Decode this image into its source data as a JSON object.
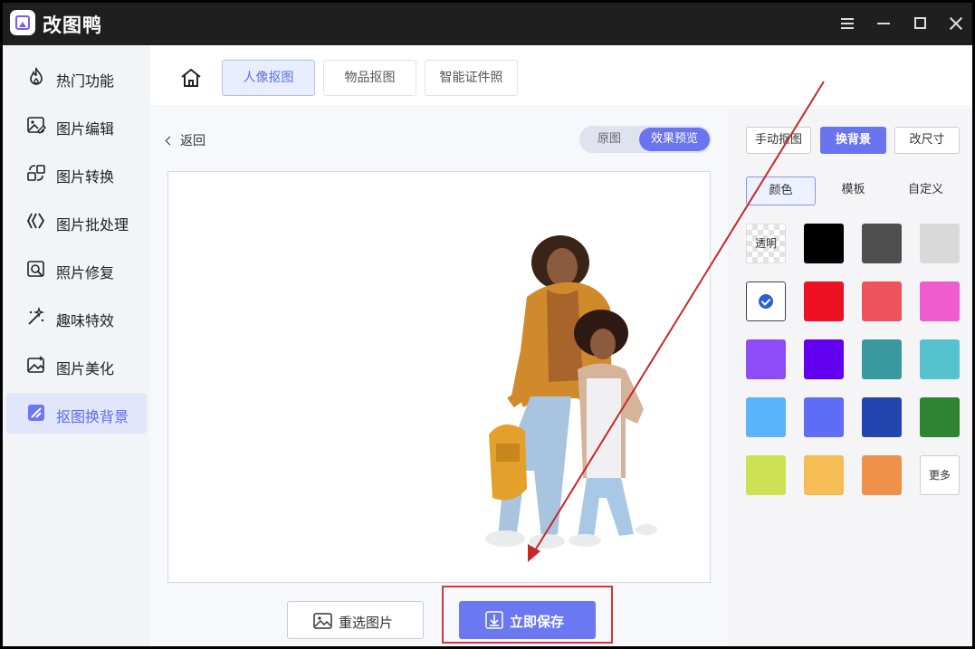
{
  "app": {
    "title": "改图鸭"
  },
  "sidebar": {
    "items": [
      {
        "label": "热门功能",
        "icon": "flame-icon"
      },
      {
        "label": "图片编辑",
        "icon": "image-edit-icon"
      },
      {
        "label": "图片转换",
        "icon": "convert-icon"
      },
      {
        "label": "图片批处理",
        "icon": "batch-icon"
      },
      {
        "label": "照片修复",
        "icon": "photo-repair-icon"
      },
      {
        "label": "趣味特效",
        "icon": "magic-wand-icon"
      },
      {
        "label": "图片美化",
        "icon": "image-beautify-icon"
      },
      {
        "label": "抠图换背景",
        "icon": "cutout-icon",
        "active": true
      }
    ]
  },
  "top_tabs": [
    "人像抠图",
    "物品抠图",
    "智能证件照"
  ],
  "workspace": {
    "back_label": "返回",
    "toggle": {
      "original": "原图",
      "preview": "效果预览"
    },
    "reselect_label": "重选图片",
    "save_label": "立即保存"
  },
  "right_panel": {
    "tools": [
      "手动抠图",
      "换背景",
      "改尺寸"
    ],
    "tabs": [
      "颜色",
      "模板",
      "自定义"
    ],
    "transparent_label": "透明",
    "more_label": "更多",
    "swatches": [
      "#000000",
      "#4f4f4f",
      "#d9d9d9",
      "#ffffff",
      "#ec1221",
      "#ee525c",
      "#ee5ccd",
      "#8e4cf9",
      "#6200ef",
      "#3a999e",
      "#54c3ce",
      "#5bb4fb",
      "#5f6cf6",
      "#2345b0",
      "#2e8431",
      "#cde252",
      "#f5bd53",
      "#f0914a"
    ]
  },
  "colors": {
    "accent": "#6a73f0",
    "annotation": "#d33333"
  }
}
